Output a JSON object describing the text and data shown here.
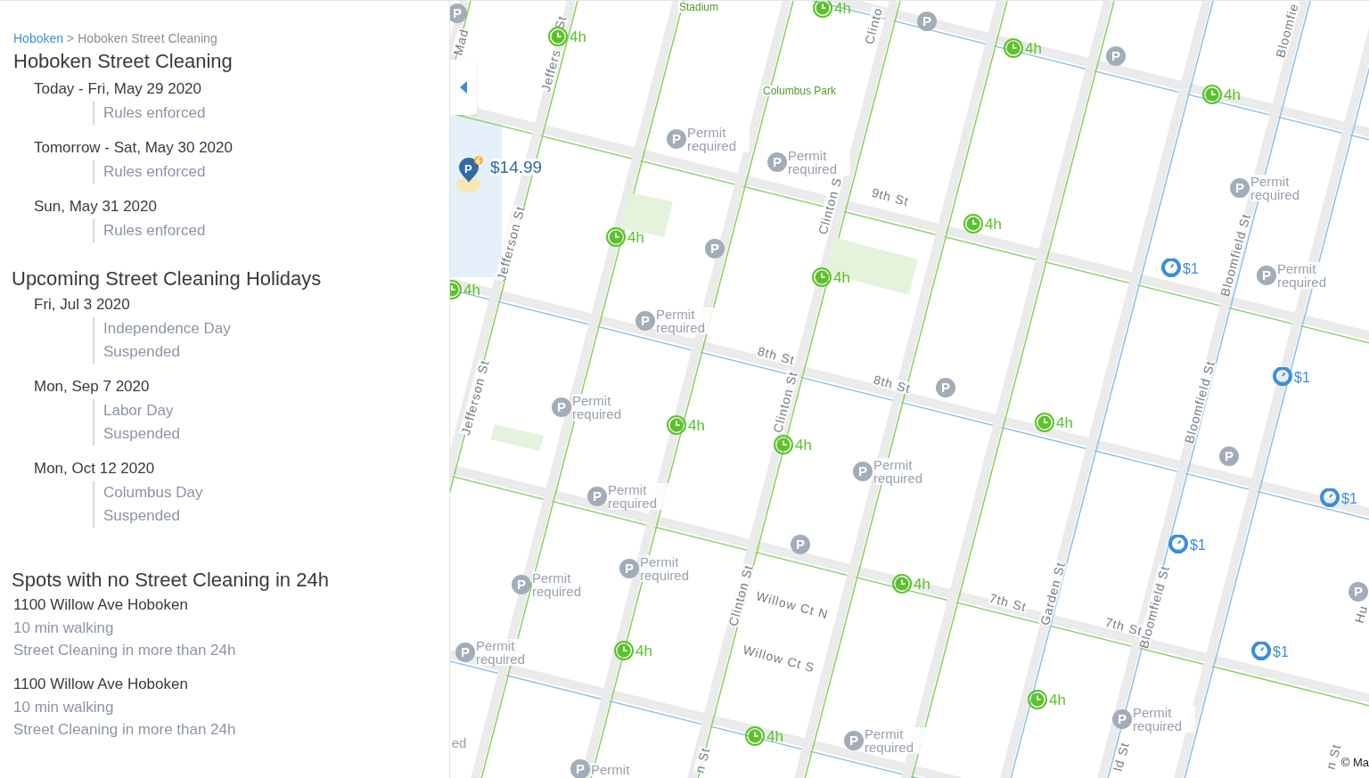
{
  "breadcrumb": {
    "parent": "Hoboken",
    "separator": ">",
    "current": "Hoboken Street Cleaning"
  },
  "title": "Hoboken Street Cleaning",
  "schedule": [
    {
      "date": "Today - Fri, May 29 2020",
      "lines": [
        "Rules enforced"
      ]
    },
    {
      "date": "Tomorrow - Sat, May 30 2020",
      "lines": [
        "Rules enforced"
      ]
    },
    {
      "date": "Sun, May 31 2020",
      "lines": [
        "Rules enforced"
      ]
    }
  ],
  "holidays_heading": "Upcoming Street Cleaning Holidays",
  "holidays": [
    {
      "date": "Fri, Jul 3 2020",
      "lines": [
        "Independence Day",
        "Suspended"
      ]
    },
    {
      "date": "Mon, Sep 7 2020",
      "lines": [
        "Labor Day",
        "Suspended"
      ]
    },
    {
      "date": "Mon, Oct 12 2020",
      "lines": [
        "Columbus Day",
        "Suspended"
      ]
    }
  ],
  "spots_heading": "Spots with no Street Cleaning in 24h",
  "spots": [
    {
      "address": "1100 Willow Ave Hoboken",
      "walk": "10 min walking",
      "note": "Street Cleaning in more than 24h"
    },
    {
      "address": "1100 Willow Ave Hoboken",
      "walk": "10 min walking",
      "note": "Street Cleaning in more than 24h"
    }
  ],
  "map": {
    "labels": [
      {
        "kind": "area",
        "text": "Stadium"
      },
      {
        "kind": "area",
        "text": "Columbus Park"
      },
      {
        "kind": "street",
        "text": "Mad"
      },
      {
        "kind": "street",
        "text": "Jeffers"
      },
      {
        "kind": "street",
        "text": "St"
      },
      {
        "kind": "street",
        "text": "Jefferson St"
      },
      {
        "kind": "street",
        "text": "Jefferson St"
      },
      {
        "kind": "street",
        "text": "Clinto"
      },
      {
        "kind": "street",
        "text": "Clinton S"
      },
      {
        "kind": "street",
        "text": "Clinton St"
      },
      {
        "kind": "street",
        "text": "Clinton St"
      },
      {
        "kind": "street",
        "text": "n St"
      },
      {
        "kind": "street",
        "text": "9th St"
      },
      {
        "kind": "street",
        "text": "8th St"
      },
      {
        "kind": "street",
        "text": "8th St"
      },
      {
        "kind": "street",
        "text": "7th St"
      },
      {
        "kind": "street",
        "text": "7th St"
      },
      {
        "kind": "street",
        "text": "Garden St"
      },
      {
        "kind": "street",
        "text": "Bloomfie"
      },
      {
        "kind": "street",
        "text": "Bloomfield St"
      },
      {
        "kind": "street",
        "text": "Bloomfield St"
      },
      {
        "kind": "street",
        "text": "Bloomfield St"
      },
      {
        "kind": "street",
        "text": "ld St"
      },
      {
        "kind": "street",
        "text": "Willow Ct N"
      },
      {
        "kind": "street",
        "text": "Willow Ct S"
      },
      {
        "kind": "street",
        "text": "Hu"
      },
      {
        "kind": "street",
        "text": "n St"
      },
      {
        "kind": "fragment",
        "text": "ed"
      }
    ],
    "markers": [
      {
        "kind": "time",
        "text": "4h"
      },
      {
        "kind": "time",
        "text": "4h"
      },
      {
        "kind": "time",
        "text": "4h"
      },
      {
        "kind": "time",
        "text": "4h"
      },
      {
        "kind": "time",
        "text": "4h"
      },
      {
        "kind": "time",
        "text": "4h"
      },
      {
        "kind": "time",
        "text": "4h"
      },
      {
        "kind": "time",
        "text": "4h"
      },
      {
        "kind": "time",
        "text": "4h"
      },
      {
        "kind": "time",
        "text": "4h"
      },
      {
        "kind": "time",
        "text": "4h"
      },
      {
        "kind": "time",
        "text": "4h"
      },
      {
        "kind": "time",
        "text": "4h"
      },
      {
        "kind": "time",
        "text": "4h"
      },
      {
        "kind": "time",
        "text": "4h"
      },
      {
        "kind": "meter",
        "text": "$1"
      },
      {
        "kind": "meter",
        "text": "$1"
      },
      {
        "kind": "meter",
        "text": "$1"
      },
      {
        "kind": "meter",
        "text": "$1"
      },
      {
        "kind": "meter",
        "text": "$1"
      },
      {
        "kind": "permit",
        "icon": "P",
        "text": "Permit required"
      },
      {
        "kind": "permit",
        "icon": "P",
        "text": "Permit required"
      },
      {
        "kind": "permit",
        "icon": "P",
        "text": "Permit required"
      },
      {
        "kind": "permit",
        "icon": "P",
        "text": "Permit required"
      },
      {
        "kind": "permit",
        "icon": "P",
        "text": "Permit required"
      },
      {
        "kind": "permit",
        "icon": "P",
        "text": "Permit required"
      },
      {
        "kind": "permit",
        "icon": "P",
        "text": "Permit required"
      },
      {
        "kind": "permit",
        "icon": "P",
        "text": "Permit required"
      },
      {
        "kind": "permit",
        "icon": "P",
        "text": "Permit required"
      },
      {
        "kind": "permit",
        "icon": "P",
        "text": "Permit required"
      },
      {
        "kind": "permit",
        "icon": "P",
        "text": "Permit required"
      },
      {
        "kind": "permit",
        "icon": "P",
        "text": "Permit required"
      },
      {
        "kind": "permit",
        "icon": "P",
        "text": "Permit required"
      },
      {
        "kind": "permit",
        "icon": "P",
        "text": "Permit"
      },
      {
        "kind": "parking",
        "icon": "P"
      },
      {
        "kind": "parking",
        "icon": "P"
      },
      {
        "kind": "parking",
        "icon": "P"
      },
      {
        "kind": "parking",
        "icon": "P"
      },
      {
        "kind": "parking",
        "icon": "P"
      },
      {
        "kind": "parking",
        "icon": "P"
      },
      {
        "kind": "parking",
        "icon": "P"
      },
      {
        "kind": "parking",
        "icon": "P"
      },
      {
        "kind": "price",
        "icon": "P",
        "text": "$14.99"
      }
    ],
    "attribution": "© Ma"
  }
}
